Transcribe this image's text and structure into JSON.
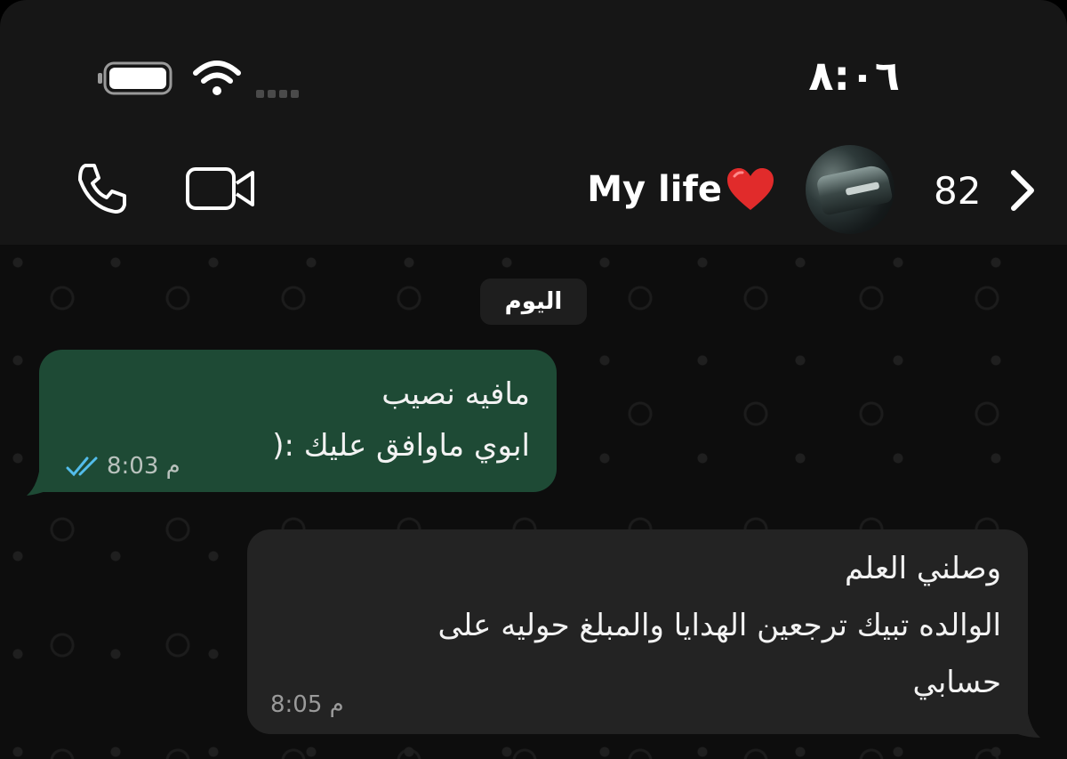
{
  "status_bar": {
    "time": "٨:٠٦",
    "battery_icon": "battery-icon",
    "wifi_icon": "wifi-icon",
    "signal_icon": "signal-dots-icon"
  },
  "header": {
    "contact_name": "My life",
    "name_emoji": "heart-emoji",
    "back_count": "82",
    "call_icon": "phone-icon",
    "video_icon": "video-camera-icon",
    "avatar": "contact-avatar"
  },
  "chat": {
    "date_separator": "اليوم",
    "messages": [
      {
        "direction": "outgoing",
        "lines": [
          "مافيه نصيب",
          "ابوي ماوافق عليك :("
        ],
        "time": "8:03",
        "period": "م",
        "status_icon": "double-check-read-icon",
        "bubble_color": "#1e4a35"
      },
      {
        "direction": "incoming",
        "lines": [
          "وصلني العلم",
          "الوالده تبيك ترجعين الهدايا والمبلغ حوليه على",
          "حسابي"
        ],
        "time": "8:05",
        "period": "م",
        "bubble_color": "#232323"
      }
    ]
  },
  "colors": {
    "background": "#0d0d0d",
    "header": "#161616",
    "read_ticks": "#53bdeb"
  }
}
